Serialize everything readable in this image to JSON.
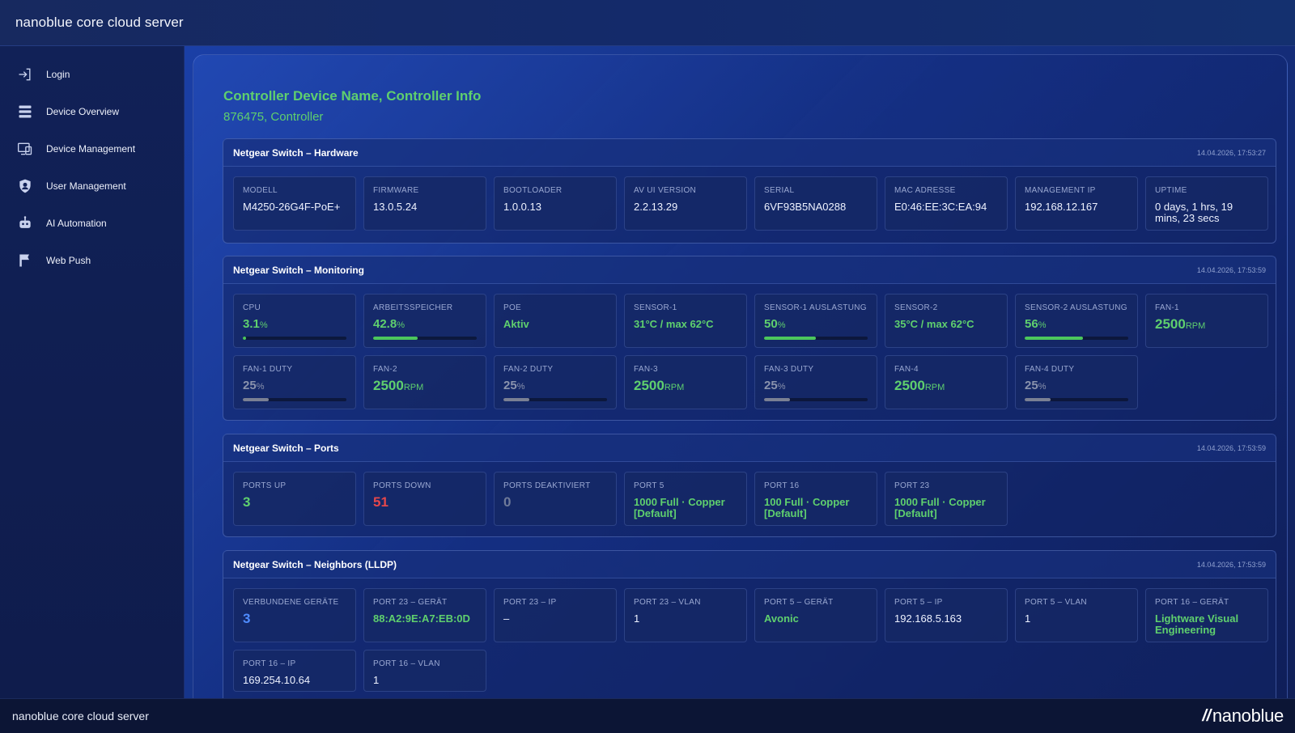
{
  "app": {
    "title": "nanoblue core cloud server"
  },
  "sidebar": {
    "items": [
      {
        "label": "Login",
        "icon": "login-icon"
      },
      {
        "label": "Device Overview",
        "icon": "server-list-icon"
      },
      {
        "label": "Device Management",
        "icon": "devices-icon"
      },
      {
        "label": "User Management",
        "icon": "user-shield-icon"
      },
      {
        "label": "AI Automation",
        "icon": "robot-icon"
      },
      {
        "label": "Web Push",
        "icon": "chat-flag-icon"
      }
    ]
  },
  "controller": {
    "title": "Controller Device Name, Controller Info",
    "subtitle": "876475, Controller"
  },
  "hardware": {
    "title": "Netgear Switch – Hardware",
    "timestamp": "14.04.2026, 17:53:27",
    "cards": [
      {
        "label": "Modell",
        "value": "M4250-26G4F-PoE+"
      },
      {
        "label": "Firmware",
        "value": "13.0.5.24"
      },
      {
        "label": "Bootloader",
        "value": "1.0.0.13"
      },
      {
        "label": "AV UI Version",
        "value": "2.2.13.29"
      },
      {
        "label": "Serial",
        "value": "6VF93B5NA0288"
      },
      {
        "label": "MAC Adresse",
        "value": "E0:46:EE:3C:EA:94"
      },
      {
        "label": "Management IP",
        "value": "192.168.12.167"
      },
      {
        "label": "Uptime",
        "value": "0 days, 1 hrs, 19 mins, 23 secs"
      }
    ]
  },
  "monitoring": {
    "title": "Netgear Switch – Monitoring",
    "timestamp": "14.04.2026, 17:53:59",
    "cpu": {
      "label": "CPU",
      "value": "3.1",
      "unit": "%",
      "level": 0.031
    },
    "memory": {
      "label": "Arbeitsspeicher",
      "value": "42.8",
      "unit": "%",
      "level": 0.428
    },
    "poe": {
      "label": "PoE",
      "value": "Aktiv"
    },
    "sensor1": {
      "label": "Sensor-1",
      "value": "31°C / max 62°C"
    },
    "sensor1_load": {
      "label": "Sensor-1 Auslastung",
      "value": "50",
      "unit": "%",
      "level": 0.5
    },
    "sensor2": {
      "label": "Sensor-2",
      "value": "35°C / max 62°C"
    },
    "sensor2_load": {
      "label": "Sensor-2 Auslastung",
      "value": "56",
      "unit": "%",
      "level": 0.56
    },
    "fan1": {
      "label": "Fan-1",
      "value": "2500",
      "unit": "RPM"
    },
    "fan1_duty": {
      "label": "Fan-1 Duty",
      "value": "25",
      "unit": "%",
      "level": 0.25
    },
    "fan2": {
      "label": "Fan-2",
      "value": "2500",
      "unit": "RPM"
    },
    "fan2_duty": {
      "label": "Fan-2 Duty",
      "value": "25",
      "unit": "%",
      "level": 0.25
    },
    "fan3": {
      "label": "Fan-3",
      "value": "2500",
      "unit": "RPM"
    },
    "fan3_duty": {
      "label": "Fan-3 Duty",
      "value": "25",
      "unit": "%",
      "level": 0.25
    },
    "fan4": {
      "label": "Fan-4",
      "value": "2500",
      "unit": "RPM"
    },
    "fan4_duty": {
      "label": "Fan-4 Duty",
      "value": "25",
      "unit": "%",
      "level": 0.25
    }
  },
  "ports": {
    "title": "Netgear Switch – Ports",
    "timestamp": "14.04.2026, 17:53:59",
    "up": {
      "label": "Ports Up",
      "value": "3"
    },
    "down": {
      "label": "Ports Down",
      "value": "51"
    },
    "disabled": {
      "label": "Ports deaktiviert",
      "value": "0"
    },
    "port5": {
      "label": "Port 5",
      "value": "1000 Full · Copper [Default]"
    },
    "port16": {
      "label": "Port 16",
      "value": "100 Full · Copper [Default]"
    },
    "port23": {
      "label": "Port 23",
      "value": "1000 Full · Copper [Default]"
    }
  },
  "neighbors": {
    "title": "Netgear Switch – Neighbors (LLDP)",
    "timestamp": "14.04.2026, 17:53:59",
    "connected": {
      "label": "Verbundene Geräte",
      "value": "3"
    },
    "p23_device": {
      "label": "Port 23 – Gerät",
      "value": "88:A2:9E:A7:EB:0D"
    },
    "p23_ip": {
      "label": "Port 23 – IP",
      "value": "–"
    },
    "p23_vlan": {
      "label": "Port 23 – VLAN",
      "value": "1"
    },
    "p5_device": {
      "label": "Port 5 – Gerät",
      "value": "Avonic"
    },
    "p5_ip": {
      "label": "Port 5 – IP",
      "value": "192.168.5.163"
    },
    "p5_vlan": {
      "label": "Port 5 – VLAN",
      "value": "1"
    },
    "p16_device": {
      "label": "Port 16 – Gerät",
      "value": "Lightware Visual Engineering"
    },
    "p16_ip": {
      "label": "Port 16 – IP",
      "value": "169.254.10.64"
    },
    "p16_vlan": {
      "label": "Port 16 – VLAN",
      "value": "1"
    }
  },
  "footer": {
    "text": "nanoblue core cloud server",
    "logo_mark": "//",
    "logo_word": "nanoblue"
  },
  "colors": {
    "accent_green": "#5fd06e",
    "alert_red": "#e5474b",
    "muted_grey": "#6f7a99",
    "link_blue": "#4f8cff"
  }
}
